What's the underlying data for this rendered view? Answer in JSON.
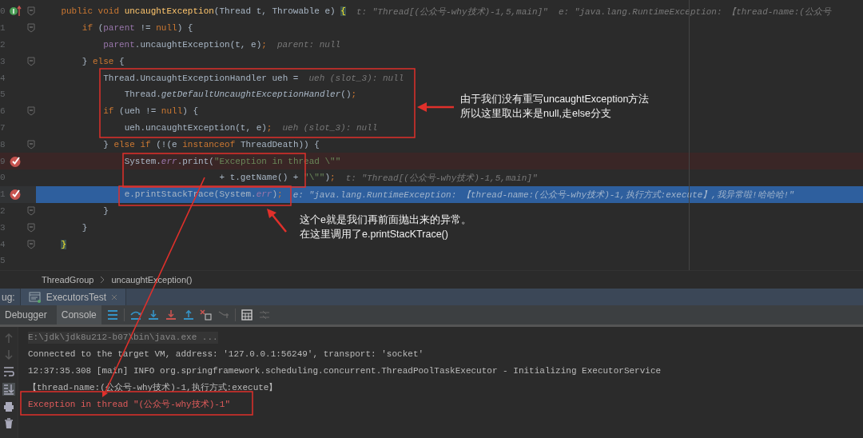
{
  "editor": {
    "lines": [
      {
        "number": "0",
        "breakpoint": false,
        "current": false,
        "fold": true,
        "override": true,
        "segments": [
          {
            "kind": "kw",
            "text": "    public void "
          },
          {
            "kind": "method",
            "text": "uncaughtException"
          },
          {
            "kind": "plain",
            "text": "(Thread t, Throwable e) "
          },
          {
            "kind": "brace",
            "text": "{"
          },
          {
            "kind": "hint",
            "text": "t: \"Thread[(公众号-why技术)-1,5,main]\"  e: \"java.lang.RuntimeException: 【thread-name:(公众号"
          }
        ]
      },
      {
        "number": "1",
        "breakpoint": false,
        "current": false,
        "fold": true,
        "override": false,
        "segments": [
          {
            "kind": "kw",
            "text": "        if "
          },
          {
            "kind": "plain",
            "text": "("
          },
          {
            "kind": "field",
            "text": "parent"
          },
          {
            "kind": "plain",
            "text": " != "
          },
          {
            "kind": "kw",
            "text": "null"
          },
          {
            "kind": "plain",
            "text": ") {"
          }
        ]
      },
      {
        "number": "2",
        "breakpoint": false,
        "current": false,
        "fold": false,
        "override": false,
        "segments": [
          {
            "kind": "field",
            "text": "            parent"
          },
          {
            "kind": "plain",
            "text": ".uncaughtException(t, e)"
          },
          {
            "kind": "kw",
            "text": ";"
          },
          {
            "kind": "hint",
            "text": "parent: null"
          }
        ]
      },
      {
        "number": "3",
        "breakpoint": false,
        "current": false,
        "fold": true,
        "override": false,
        "segments": [
          {
            "kind": "plain",
            "text": "        } "
          },
          {
            "kind": "kw",
            "text": "else"
          },
          {
            "kind": "plain",
            "text": " {"
          }
        ]
      },
      {
        "number": "4",
        "breakpoint": false,
        "current": false,
        "fold": false,
        "override": false,
        "segments": [
          {
            "kind": "plain",
            "text": "            Thread.UncaughtExceptionHandler ueh ="
          },
          {
            "kind": "hint",
            "text": "ueh (slot_3): null"
          }
        ]
      },
      {
        "number": "5",
        "breakpoint": false,
        "current": false,
        "fold": false,
        "override": false,
        "segments": [
          {
            "kind": "plain",
            "text": "                Thread."
          },
          {
            "kind": "static",
            "text": "getDefaultUncaughtExceptionHandler"
          },
          {
            "kind": "plain",
            "text": "()"
          },
          {
            "kind": "kw",
            "text": ";"
          }
        ]
      },
      {
        "number": "6",
        "breakpoint": false,
        "current": false,
        "fold": true,
        "override": false,
        "segments": [
          {
            "kind": "kw",
            "text": "            if "
          },
          {
            "kind": "plain",
            "text": "(ueh != "
          },
          {
            "kind": "kw",
            "text": "null"
          },
          {
            "kind": "plain",
            "text": ") {"
          }
        ]
      },
      {
        "number": "7",
        "breakpoint": false,
        "current": false,
        "fold": false,
        "override": false,
        "segments": [
          {
            "kind": "plain",
            "text": "                ueh.uncaughtException(t, e)"
          },
          {
            "kind": "kw",
            "text": ";"
          },
          {
            "kind": "hint",
            "text": "ueh (slot_3): null"
          }
        ]
      },
      {
        "number": "8",
        "breakpoint": false,
        "current": false,
        "fold": true,
        "override": false,
        "segments": [
          {
            "kind": "plain",
            "text": "            } "
          },
          {
            "kind": "kw",
            "text": "else if "
          },
          {
            "kind": "plain",
            "text": "(!(e "
          },
          {
            "kind": "kw",
            "text": "instanceof "
          },
          {
            "kind": "plain",
            "text": "ThreadDeath)) {"
          }
        ]
      },
      {
        "number": "9",
        "breakpoint": true,
        "current": false,
        "fold": false,
        "override": false,
        "segments": [
          {
            "kind": "plain",
            "text": "                System."
          },
          {
            "kind": "staticfield",
            "text": "err"
          },
          {
            "kind": "plain",
            "text": ".print("
          },
          {
            "kind": "str",
            "text": "\"Exception in thread \\\"\""
          }
        ]
      },
      {
        "number": "0",
        "breakpoint": false,
        "current": false,
        "fold": false,
        "override": false,
        "segments": [
          {
            "kind": "plain",
            "text": "                                  + t.getName() + "
          },
          {
            "kind": "str",
            "text": "\"\\\"\""
          },
          {
            "kind": "plain",
            "text": ")"
          },
          {
            "kind": "kw",
            "text": ";"
          },
          {
            "kind": "hint",
            "text": "t: \"Thread[(公众号-why技术)-1,5,main]\""
          }
        ]
      },
      {
        "number": "1",
        "breakpoint": true,
        "current": true,
        "fold": false,
        "override": false,
        "segments": [
          {
            "kind": "plain",
            "text": "                e.printStackTrace(System."
          },
          {
            "kind": "staticfield",
            "text": "err"
          },
          {
            "kind": "plain",
            "text": ")"
          },
          {
            "kind": "kw",
            "text": ";"
          },
          {
            "kind": "hint",
            "text": "e: \"java.lang.RuntimeException: 【thread-name:(公众号-why技术)-1,执行方式:execute】,我异常啦!哈哈哈!\""
          }
        ]
      },
      {
        "number": "2",
        "breakpoint": false,
        "current": false,
        "fold": true,
        "override": false,
        "segments": [
          {
            "kind": "plain",
            "text": "            }"
          }
        ]
      },
      {
        "number": "3",
        "breakpoint": false,
        "current": false,
        "fold": true,
        "override": false,
        "segments": [
          {
            "kind": "plain",
            "text": "        }"
          }
        ]
      },
      {
        "number": "4",
        "breakpoint": false,
        "current": false,
        "fold": true,
        "override": false,
        "segments": [
          {
            "kind": "brace",
            "text": "    }"
          }
        ]
      },
      {
        "number": "5",
        "breakpoint": false,
        "current": false,
        "fold": false,
        "override": false
      }
    ]
  },
  "callouts": [
    {
      "lines": [
        "由于我们没有重写uncaughtException方法",
        "所以这里取出来是null,走else分支"
      ]
    },
    {
      "lines": [
        "这个e就是我们再前面抛出来的异常。",
        "在这里调用了e.printStacKTrace()"
      ]
    }
  ],
  "breadcrumb": [
    "ThreadGroup",
    "uncaughtException()"
  ],
  "debug_panel": {
    "label": "ug:",
    "session_tab": "ExecutorsTest",
    "tabs": [
      {
        "label": "Debugger",
        "selected": false
      },
      {
        "label": "Console",
        "selected": true
      }
    ]
  },
  "console": {
    "lines": [
      {
        "kind": "command",
        "text": "E:\\jdk\\jdk8u212-b07\\bin\\java.exe ..."
      },
      {
        "kind": "output",
        "text": "Connected to the target VM, address: '127.0.0.1:56249', transport: 'socket'"
      },
      {
        "kind": "output",
        "text": "12:37:35.308 [main] INFO org.springframework.scheduling.concurrent.ThreadPoolTaskExecutor - Initializing ExecutorService"
      },
      {
        "kind": "output",
        "text": "【thread-name:(公众号-why技术)-1,执行方式:execute】"
      },
      {
        "kind": "error",
        "text": "Exception in thread \"(公众号-why技术)-1\""
      }
    ]
  }
}
